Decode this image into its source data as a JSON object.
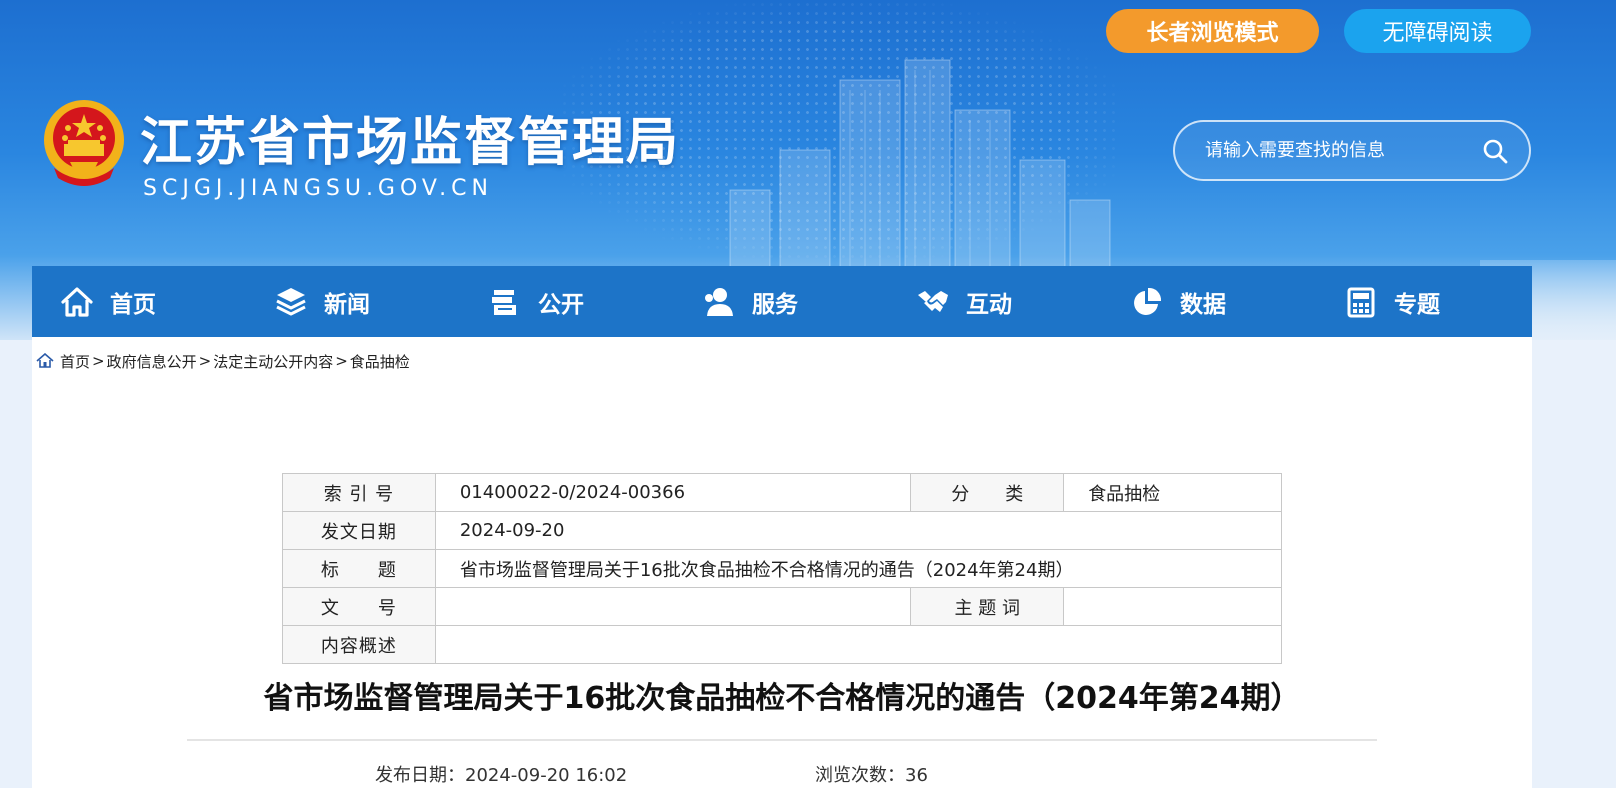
{
  "header": {
    "site_title": "江苏省市场监督管理局",
    "site_domain": "SCJGJ.JIANGSU.GOV.CN",
    "elder_mode_label": "长者浏览模式",
    "accessibility_label": "无障碍阅读",
    "search_placeholder": "请输入需要查找的信息"
  },
  "nav": {
    "items": [
      {
        "label": "首页",
        "icon": "home-icon"
      },
      {
        "label": "新闻",
        "icon": "layers-icon"
      },
      {
        "label": "公开",
        "icon": "documents-icon"
      },
      {
        "label": "服务",
        "icon": "user-icon"
      },
      {
        "label": "互动",
        "icon": "handshake-icon"
      },
      {
        "label": "数据",
        "icon": "pie-chart-icon"
      },
      {
        "label": "专题",
        "icon": "calculator-icon"
      }
    ]
  },
  "breadcrumb": {
    "items": [
      "首页",
      "政府信息公开",
      "法定主动公开内容",
      "食品抽检"
    ],
    "separator": ">"
  },
  "meta": {
    "index_label": "索 引 号",
    "index_value": "01400022-0/2024-00366",
    "category_label": "分　　类",
    "category_value": "食品抽检",
    "date_label": "发文日期",
    "date_value": "2024-09-20",
    "title_label": "标　　题",
    "title_value": "省市场监督管理局关于16批次食品抽检不合格情况的通告（2024年第24期）",
    "docno_label": "文　　号",
    "docno_value": "",
    "keywords_label": "主 题 词",
    "keywords_value": "",
    "summary_label": "内容概述",
    "summary_value": ""
  },
  "article": {
    "title": "省市场监督管理局关于16批次食品抽检不合格情况的通告（2024年第24期）",
    "publish_label": "发布日期：",
    "publish_value": "2024-09-20 16:02",
    "views_label": "浏览次数：",
    "views_value": "36"
  },
  "colors": {
    "nav_bg": "#1d74c8",
    "elder_btn": "#f39a2c",
    "access_btn": "#1ba3ee"
  }
}
